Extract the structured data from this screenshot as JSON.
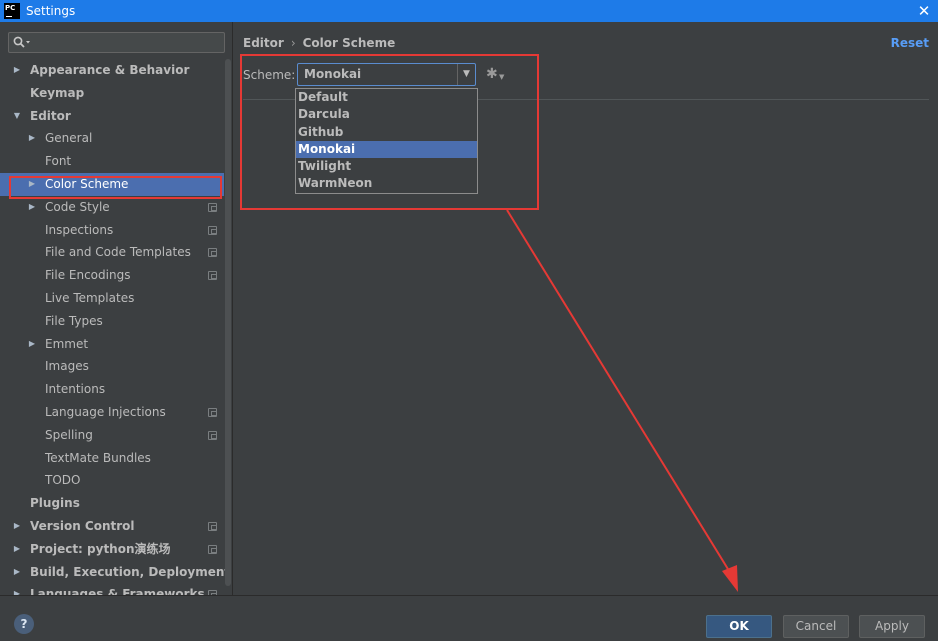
{
  "window": {
    "title": "Settings",
    "app_icon": "PC"
  },
  "sidebar": {
    "search": {
      "placeholder": "",
      "value": ""
    },
    "items": [
      {
        "label": "Appearance & Behavior",
        "level": 0,
        "arrow": "collapsed",
        "bold": true,
        "copy": false
      },
      {
        "label": "Keymap",
        "level": 0,
        "arrow": "none",
        "bold": true,
        "copy": false
      },
      {
        "label": "Editor",
        "level": 0,
        "arrow": "expanded",
        "bold": true,
        "copy": false
      },
      {
        "label": "General",
        "level": 1,
        "arrow": "collapsed",
        "bold": false,
        "copy": false
      },
      {
        "label": "Font",
        "level": 1,
        "arrow": "none",
        "bold": false,
        "copy": false
      },
      {
        "label": "Color Scheme",
        "level": 1,
        "arrow": "collapsed",
        "bold": false,
        "copy": false,
        "selected": true
      },
      {
        "label": "Code Style",
        "level": 1,
        "arrow": "collapsed",
        "bold": false,
        "copy": true
      },
      {
        "label": "Inspections",
        "level": 1,
        "arrow": "none",
        "bold": false,
        "copy": true
      },
      {
        "label": "File and Code Templates",
        "level": 1,
        "arrow": "none",
        "bold": false,
        "copy": true
      },
      {
        "label": "File Encodings",
        "level": 1,
        "arrow": "none",
        "bold": false,
        "copy": true
      },
      {
        "label": "Live Templates",
        "level": 1,
        "arrow": "none",
        "bold": false,
        "copy": false
      },
      {
        "label": "File Types",
        "level": 1,
        "arrow": "none",
        "bold": false,
        "copy": false
      },
      {
        "label": "Emmet",
        "level": 1,
        "arrow": "collapsed",
        "bold": false,
        "copy": false
      },
      {
        "label": "Images",
        "level": 1,
        "arrow": "none",
        "bold": false,
        "copy": false
      },
      {
        "label": "Intentions",
        "level": 1,
        "arrow": "none",
        "bold": false,
        "copy": false
      },
      {
        "label": "Language Injections",
        "level": 1,
        "arrow": "none",
        "bold": false,
        "copy": true
      },
      {
        "label": "Spelling",
        "level": 1,
        "arrow": "none",
        "bold": false,
        "copy": true
      },
      {
        "label": "TextMate Bundles",
        "level": 1,
        "arrow": "none",
        "bold": false,
        "copy": false
      },
      {
        "label": "TODO",
        "level": 1,
        "arrow": "none",
        "bold": false,
        "copy": false
      },
      {
        "label": "Plugins",
        "level": 0,
        "arrow": "none",
        "bold": true,
        "copy": false
      },
      {
        "label": "Version Control",
        "level": 0,
        "arrow": "collapsed",
        "bold": true,
        "copy": true
      },
      {
        "label": "Project: python演练场",
        "level": 0,
        "arrow": "collapsed",
        "bold": true,
        "copy": true
      },
      {
        "label": "Build, Execution, Deployment",
        "level": 0,
        "arrow": "collapsed",
        "bold": true,
        "copy": false
      },
      {
        "label": "Languages & Frameworks",
        "level": 0,
        "arrow": "collapsed",
        "bold": true,
        "copy": true
      }
    ]
  },
  "main": {
    "breadcrumb": {
      "parent": "Editor",
      "separator": "›",
      "current": "Color Scheme"
    },
    "reset_label": "Reset",
    "scheme_label": "Scheme:",
    "scheme_value": "Monokai",
    "scheme_options": [
      "Default",
      "Darcula",
      "Github",
      "Monokai",
      "Twilight",
      "WarmNeon"
    ],
    "selected_option": "Monokai"
  },
  "footer": {
    "help_label": "?",
    "ok_label": "OK",
    "cancel_label": "Cancel",
    "apply_label": "Apply"
  },
  "colors": {
    "title_bar": "#1e7be8",
    "background": "#3c3f41",
    "selection": "#4b6eaf",
    "annotation": "#e53935",
    "link": "#589df6"
  },
  "icons": {
    "search": "search-icon",
    "gear": "gear-icon",
    "help": "help-icon",
    "close": "close-icon"
  }
}
